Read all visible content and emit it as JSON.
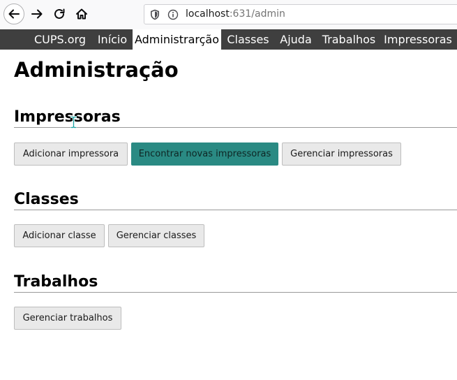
{
  "browser": {
    "url_host": "localhost",
    "url_rest": ":631/admin"
  },
  "nav": {
    "items": [
      {
        "label": "CUPS.org"
      },
      {
        "label": "Início"
      },
      {
        "label": "Administrarção"
      },
      {
        "label": "Classes"
      },
      {
        "label": "Ajuda"
      },
      {
        "label": "Trabalhos"
      },
      {
        "label": "Impressoras"
      }
    ],
    "active_index": 2
  },
  "page": {
    "title": "Administração"
  },
  "sections": {
    "printers": {
      "title": "Impressoras",
      "buttons": [
        "Adicionar impressora",
        "Encontrar novas impressoras",
        "Gerenciar impressoras"
      ],
      "highlighted_button_index": 1
    },
    "classes": {
      "title": "Classes",
      "buttons": [
        "Adicionar classe",
        "Gerenciar classes"
      ]
    },
    "jobs": {
      "title": "Trabalhos",
      "buttons": [
        "Gerenciar trabalhos"
      ]
    }
  },
  "colors": {
    "nav_bg": "#3f3f3f",
    "highlight_button": "#2a8a83"
  },
  "icons": {
    "back": "back-arrow-icon",
    "forward": "forward-arrow-icon",
    "reload": "reload-icon",
    "home": "home-icon",
    "shield": "shield-icon",
    "info": "info-icon",
    "cursor": "text-cursor-icon"
  }
}
